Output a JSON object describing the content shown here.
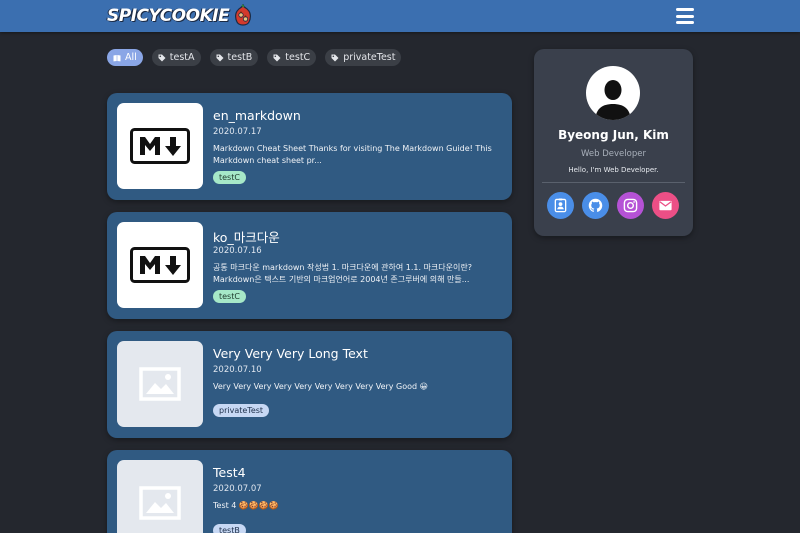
{
  "header": {
    "logo_text": "SPICYCOOKIE",
    "menu_icon": "hamburger-menu-icon",
    "background": "#3b6fb0"
  },
  "tag_filters": [
    {
      "label": "All",
      "icon": "book-icon",
      "active": true
    },
    {
      "label": "testA",
      "icon": "tag-icon",
      "active": false
    },
    {
      "label": "testB",
      "icon": "tag-icon",
      "active": false
    },
    {
      "label": "testC",
      "icon": "tag-icon",
      "active": false
    },
    {
      "label": "privateTest",
      "icon": "tag-icon",
      "active": false
    }
  ],
  "posts": [
    {
      "title": "en_markdown",
      "date": "2020.07.17",
      "description": "Markdown Cheat Sheet Thanks for visiting The Markdown Guide! This Markdown cheat sheet pr...",
      "tag": "testC",
      "thumbnail": "markdown-logo-icon"
    },
    {
      "title": "ko_마크다운",
      "date": "2020.07.16",
      "description": "공통 마크다운 markdown 작성법 1. 마크다운에 관하여 1.1. 마크다운이란? Markdown은 텍스트 기반의 마크업언어로 2004년 존그루버에 의해 만들...",
      "tag": "testC",
      "thumbnail": "markdown-logo-icon"
    },
    {
      "title": "Very Very Very Long Text",
      "date": "2020.07.10",
      "description": "Very Very Very Very Very Very Very Very Very Good 😀",
      "tag": "privateTest",
      "thumbnail": "image-placeholder-icon"
    },
    {
      "title": "Test4",
      "date": "2020.07.07",
      "description": "Test 4 🍪🍪🍪🍪",
      "tag": "testB",
      "thumbnail": "image-placeholder-icon"
    }
  ],
  "profile": {
    "name": "Byeong Jun, Kim",
    "role": "Web Developer",
    "bio": "Hello, I'm Web Developer.",
    "avatar_icon": "person-silhouette-icon",
    "socials": [
      {
        "icon": "contact-card-icon",
        "color": "#4a8ee8"
      },
      {
        "icon": "github-icon",
        "color": "#4a8ee8"
      },
      {
        "icon": "instagram-icon",
        "color": "#b552d6"
      },
      {
        "icon": "mail-icon",
        "color": "#ec4f86"
      }
    ]
  }
}
